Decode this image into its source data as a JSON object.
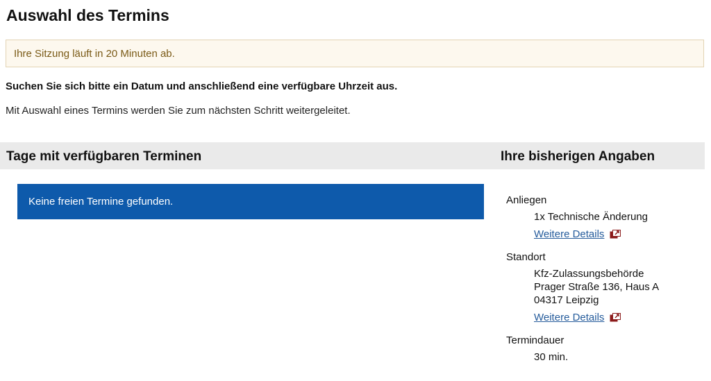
{
  "page": {
    "title": "Auswahl des Termins",
    "session_notice": "Ihre Sitzung läuft in 20 Minuten ab.",
    "intro_bold": "Suchen Sie sich bitte ein Datum und anschließend eine verfügbare Uhrzeit aus.",
    "intro_text": "Mit Auswahl eines Termins werden Sie zum nächsten Schritt weitergeleitet."
  },
  "available_days": {
    "heading": "Tage mit verfügbaren Terminen",
    "no_slots_message": "Keine freien Termine gefunden."
  },
  "summary": {
    "heading": "Ihre bisherigen Angaben",
    "concern": {
      "label": "Anliegen",
      "value": "1x  Technische Änderung",
      "details_link": "Weitere Details"
    },
    "location": {
      "label": "Standort",
      "lines": [
        "Kfz-Zulassungsbehörde",
        "Prager Straße 136, Haus A",
        "04317 Leipzig"
      ],
      "details_link": "Weitere Details"
    },
    "duration": {
      "label": "Termindauer",
      "value": "30 min."
    }
  },
  "icons": {
    "details_link_icon": "external-window-icon"
  },
  "colors": {
    "notice_bg": "#fdf8ee",
    "notice_text": "#7a5a16",
    "alert_bg": "#0e5aab",
    "link": "#245b9b",
    "section_bar": "#eaeaea",
    "icon": "#8b1a1a"
  }
}
